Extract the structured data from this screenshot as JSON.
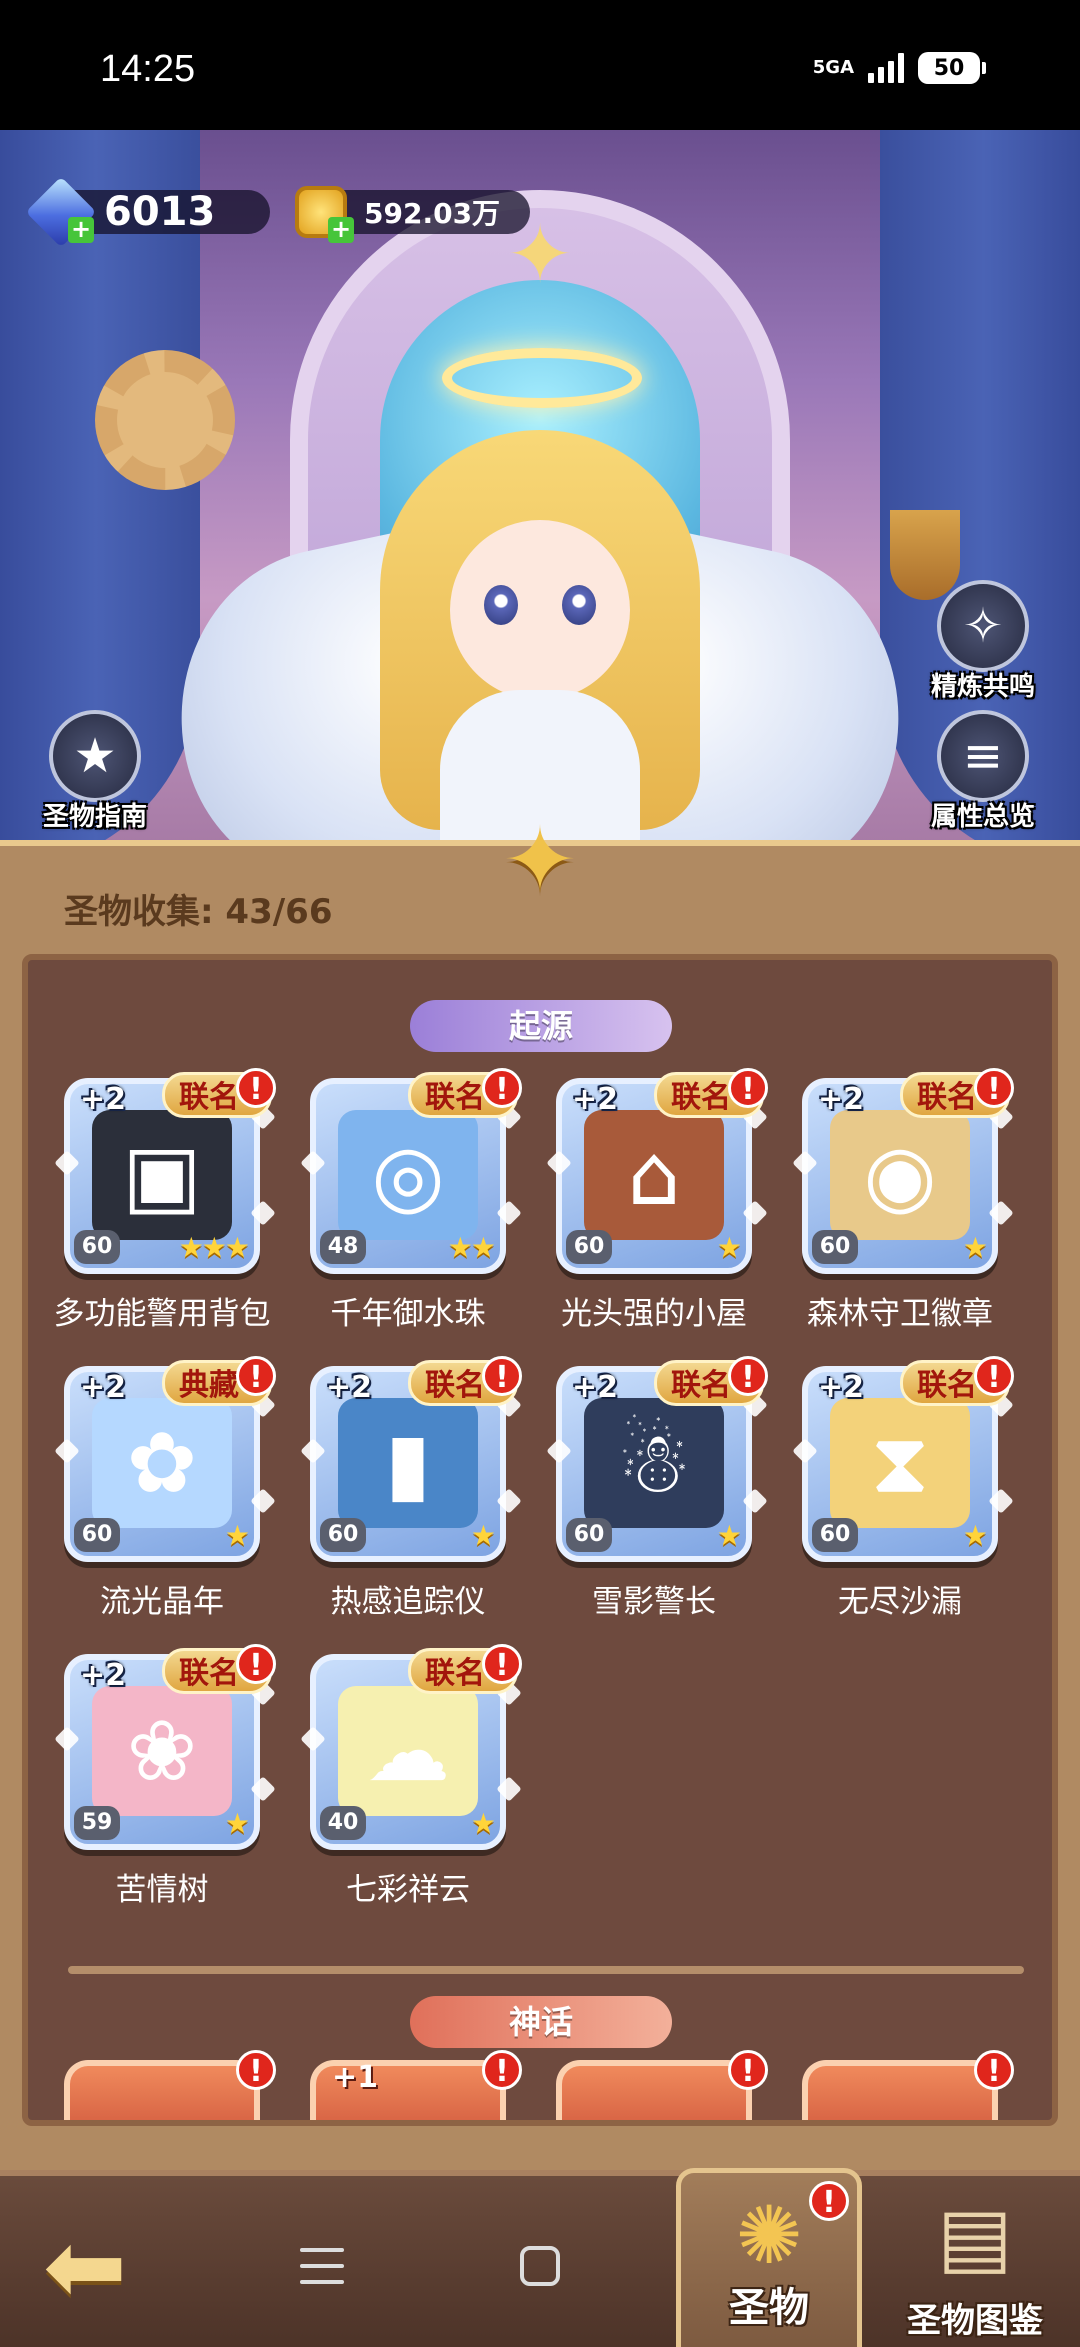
{
  "status_bar": {
    "time": "14:25",
    "network": "5GA",
    "battery": "50"
  },
  "resources": {
    "gems": "6013",
    "gold": "592.03万"
  },
  "side_buttons": {
    "guide": "圣物指南",
    "refine": "精炼共鸣",
    "attributes": "属性总览"
  },
  "collection": {
    "title": "圣物收集: 43/66",
    "sections": {
      "origin": "起源",
      "myth": "神话"
    },
    "origin_items": [
      {
        "name": "多功能警用背包",
        "bonus": "+2",
        "tag": "联名",
        "level": "60",
        "stars": "★★★",
        "alert": "!"
      },
      {
        "name": "千年御水珠",
        "bonus": "",
        "tag": "联名",
        "level": "48",
        "stars": "★★",
        "alert": "!"
      },
      {
        "name": "光头强的小屋",
        "bonus": "+2",
        "tag": "联名",
        "level": "60",
        "stars": "★",
        "alert": "!"
      },
      {
        "name": "森林守卫徽章",
        "bonus": "+2",
        "tag": "联名",
        "level": "60",
        "stars": "★",
        "alert": "!"
      },
      {
        "name": "流光晶年",
        "bonus": "+2",
        "tag": "典藏",
        "level": "60",
        "stars": "★",
        "alert": "!"
      },
      {
        "name": "热感追踪仪",
        "bonus": "+2",
        "tag": "联名",
        "level": "60",
        "stars": "★",
        "alert": "!"
      },
      {
        "name": "雪影警长",
        "bonus": "+2",
        "tag": "联名",
        "level": "60",
        "stars": "★",
        "alert": "!"
      },
      {
        "name": "无尽沙漏",
        "bonus": "+2",
        "tag": "联名",
        "level": "60",
        "stars": "★",
        "alert": "!"
      },
      {
        "name": "苦情树",
        "bonus": "+2",
        "tag": "联名",
        "level": "59",
        "stars": "★",
        "alert": "!"
      },
      {
        "name": "七彩祥云",
        "bonus": "",
        "tag": "联名",
        "level": "40",
        "stars": "★",
        "alert": "!"
      }
    ],
    "myth_items": [
      {
        "bonus": "",
        "alert": "!"
      },
      {
        "bonus": "+1",
        "alert": "!"
      },
      {
        "bonus": "",
        "alert": "!"
      },
      {
        "bonus": "",
        "alert": "!"
      }
    ]
  },
  "bottom_nav": {
    "relic_tab": "圣物",
    "relic_alert": "!",
    "codex_tab": "圣物图鉴"
  }
}
